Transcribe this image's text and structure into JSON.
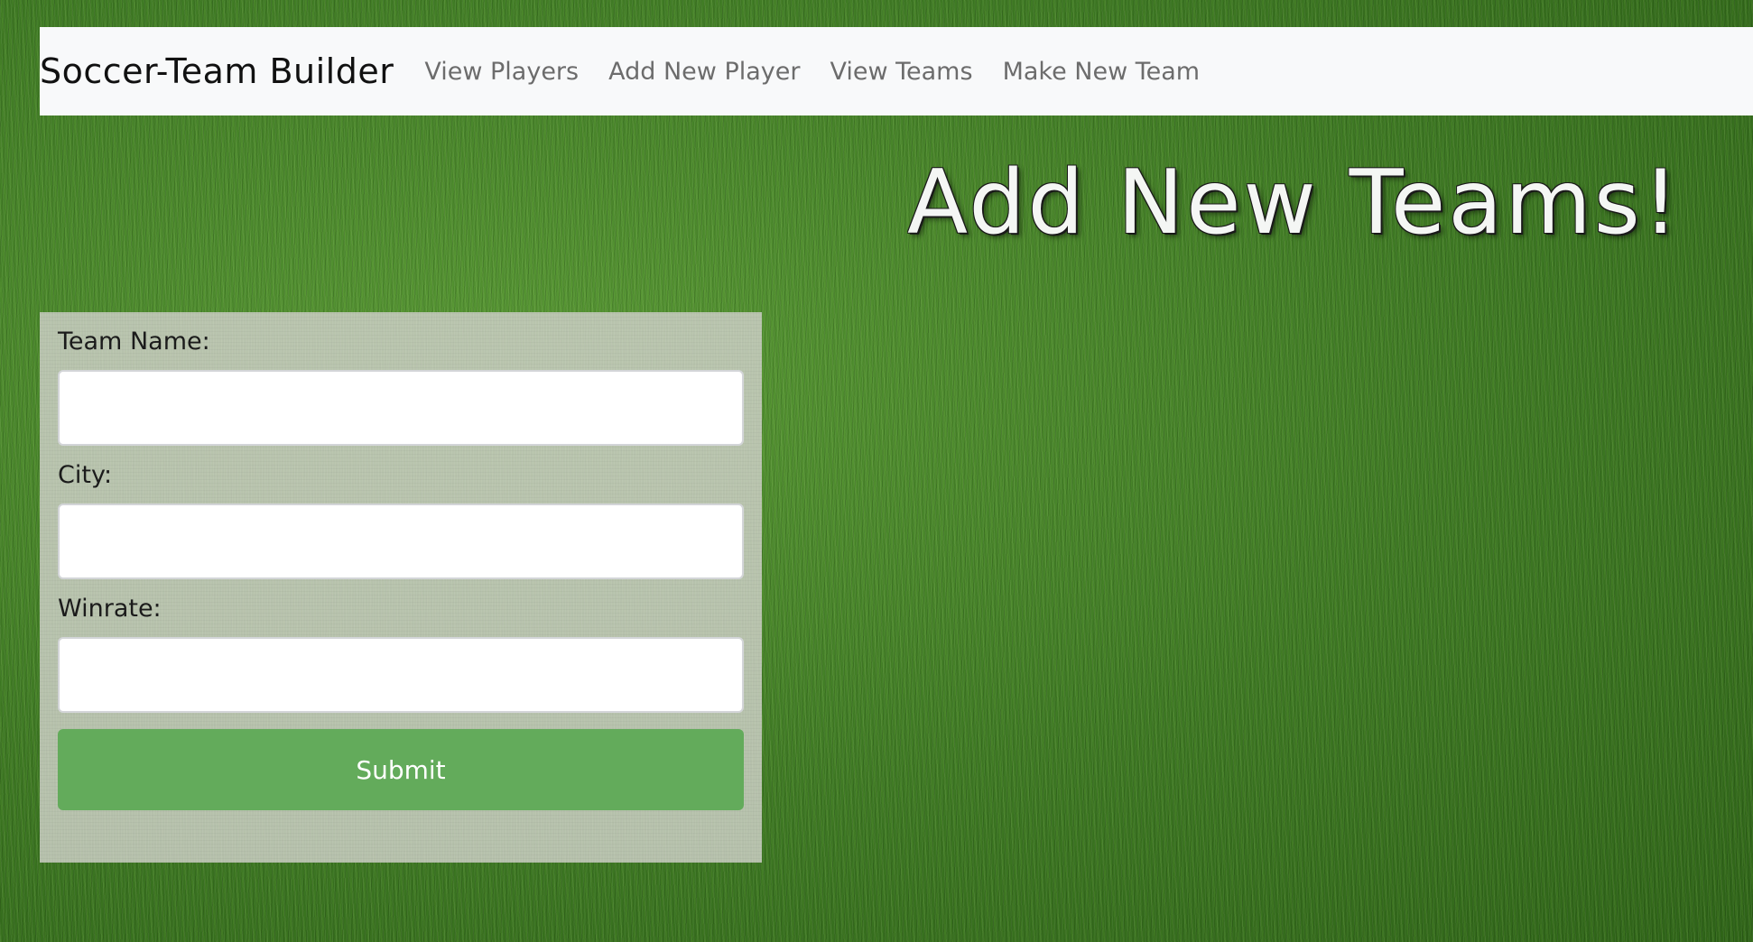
{
  "navbar": {
    "brand": "Soccer-Team Builder",
    "links": [
      {
        "label": "View Players"
      },
      {
        "label": "Add New Player"
      },
      {
        "label": "View Teams"
      },
      {
        "label": "Make New Team"
      }
    ]
  },
  "heading": "Add New Teams!",
  "form": {
    "fields": [
      {
        "label": "Team Name:",
        "value": "",
        "placeholder": ""
      },
      {
        "label": "City:",
        "value": "",
        "placeholder": ""
      },
      {
        "label": "Winrate:",
        "value": "",
        "placeholder": ""
      }
    ],
    "submit_label": "Submit"
  },
  "colors": {
    "navbar_bg": "#f8f9fa",
    "submit_bg": "#63ab5b",
    "background": "#3f7a24"
  }
}
